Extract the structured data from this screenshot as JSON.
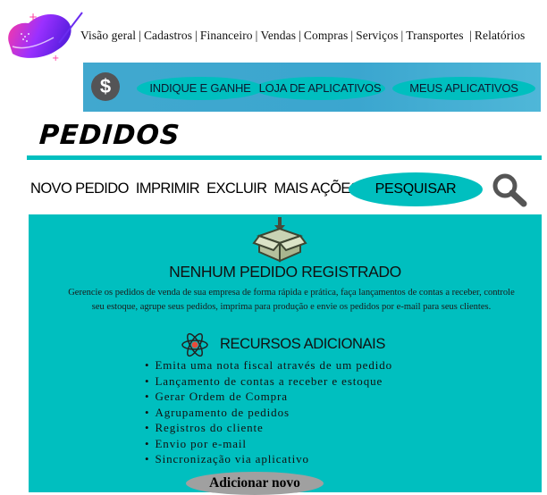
{
  "nav": {
    "items": [
      "Visão geral",
      "Cadastros",
      "Financeiro",
      "Vendas",
      "Compras",
      "Serviços",
      "Transportes",
      "Relatórios"
    ]
  },
  "banner": {
    "dollar_symbol": "$",
    "buttons": [
      "INDIQUE E GANHE",
      "LOJA DE APLICATIVOS",
      "MEUS APLICATIVOS"
    ]
  },
  "page": {
    "title": "PEDIDOS"
  },
  "toolbar": {
    "actions": [
      "NOVO PEDIDO",
      "IMPRIMIR",
      "EXCLUIR",
      "MAIS AÇÕES"
    ],
    "search_label": "PESQUISAR"
  },
  "empty_state": {
    "title": "NENHUM PEDIDO REGISTRADO",
    "description": "Gerencie os pedidos de venda de sua empresa de forma rápida e prática, faça lançamentos de contas a receber, controle seu estoque, agrupe seus pedidos, imprima para produção e envie os pedidos por e-mail para seus clientes."
  },
  "resources": {
    "title": "RECURSOS ADICIONAIS",
    "items": [
      "Emita uma nota fiscal através de um pedido",
      "Lançamento de contas a receber e estoque",
      "Gerar Ordem de Compra",
      "Agrupamento de pedidos",
      "Registros do cliente",
      "Envio por e-mail",
      "Sincronização via aplicativo"
    ]
  },
  "add_button_label": "Adicionar novo",
  "colors": {
    "accent": "#00bfbf",
    "banner": "#41a8cf",
    "button_gray": "#a0a0a0",
    "logo_purple": "#7b2ff7",
    "logo_pink": "#ff2e9a"
  },
  "icons": [
    "logo-icon",
    "dollar-icon",
    "search-icon",
    "box-icon",
    "atom-icon"
  ]
}
